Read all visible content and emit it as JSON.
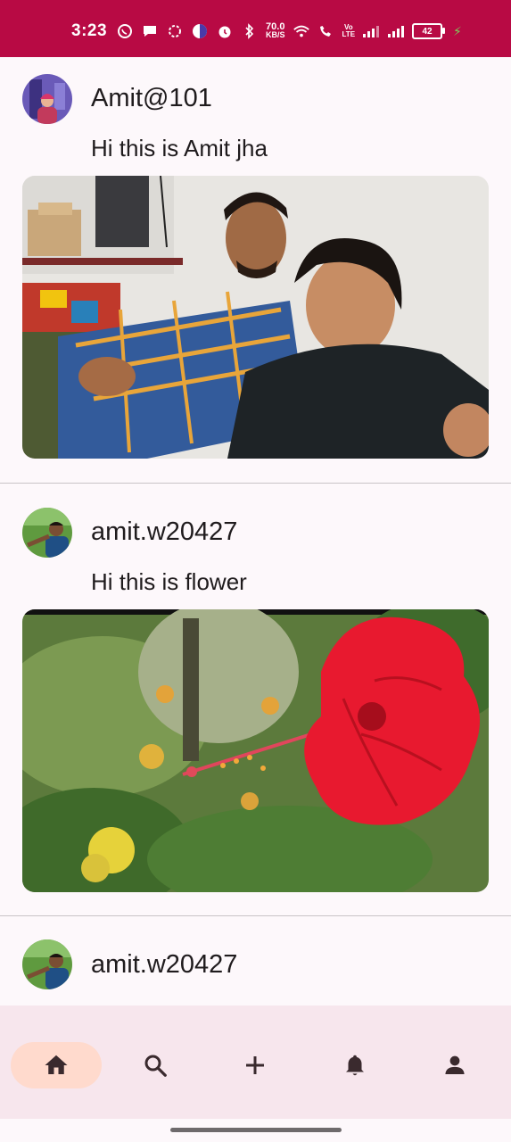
{
  "status_bar": {
    "time": "3:23",
    "speed_value": "70.0",
    "speed_unit": "KB/S",
    "volte_line1": "Vo",
    "volte_line2": "LTE",
    "battery": "42"
  },
  "posts": [
    {
      "username": "Amit@101",
      "caption": "Hi this is Amit jha",
      "image": "selfie-photo"
    },
    {
      "username": "amit.w20427",
      "caption": "Hi this is flower",
      "image": "hibiscus-photo"
    },
    {
      "username": "amit.w20427",
      "caption": "",
      "image": ""
    }
  ],
  "bottom_nav": {
    "items": [
      {
        "icon": "home-icon",
        "active": true
      },
      {
        "icon": "search-icon",
        "active": false
      },
      {
        "icon": "add-icon",
        "active": false
      },
      {
        "icon": "notifications-icon",
        "active": false
      },
      {
        "icon": "profile-icon",
        "active": false
      }
    ]
  },
  "colors": {
    "status_bar": "#b80a44",
    "nav_background": "#f7e6ed",
    "nav_active_pill": "#ffdacd",
    "icon": "#3a2a2e"
  }
}
